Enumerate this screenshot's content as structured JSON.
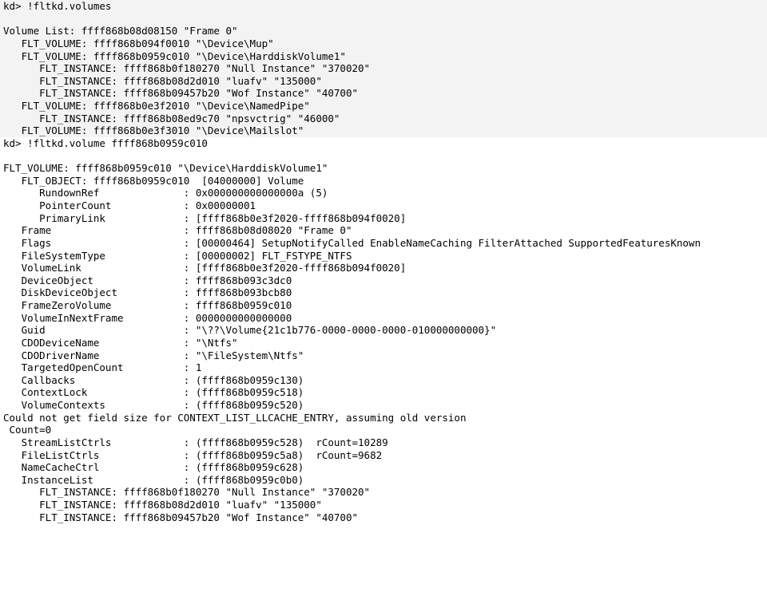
{
  "block1": {
    "prompt": "kd> ",
    "command": "!fltkd.volumes",
    "volume_list": {
      "label": "Volume List:",
      "addr": "ffff868b08d08150",
      "name": "\"Frame 0\""
    },
    "flt_volumes": [
      {
        "addr": "ffff868b094f0010",
        "name": "\"\\Device\\Mup\""
      },
      {
        "addr": "ffff868b0959c010",
        "name": "\"\\Device\\HarddiskVolume1\"",
        "instances": [
          {
            "addr": "ffff868b0f180270",
            "n1": "\"Null Instance\"",
            "n2": "\"370020\""
          },
          {
            "addr": "ffff868b08d2d010",
            "n1": "\"luafv\"",
            "n2": "\"135000\""
          },
          {
            "addr": "ffff868b09457b20",
            "n1": "\"Wof Instance\"",
            "n2": "\"40700\""
          }
        ]
      },
      {
        "addr": "ffff868b0e3f2010",
        "name": "\"\\Device\\NamedPipe\"",
        "instances": [
          {
            "addr": "ffff868b08ed9c70",
            "n1": "\"npsvctrig\"",
            "n2": "\"46000\""
          }
        ]
      },
      {
        "addr": "ffff868b0e3f3010",
        "name": "\"\\Device\\Mailslot\""
      }
    ]
  },
  "block2": {
    "prompt": "kd> ",
    "command": "!fltkd.volume ffff868b0959c010",
    "volume_header": {
      "addr": "ffff868b0959c010",
      "name": "\"\\Device\\HarddiskVolume1\""
    },
    "flt_object": {
      "addr": "ffff868b0959c010",
      "flags": "[04000000]",
      "type": "Volume"
    },
    "fields1": [
      {
        "k": "RundownRef",
        "v": "0x000000000000000a (5)"
      },
      {
        "k": "PointerCount",
        "v": "0x00000001"
      },
      {
        "k": "PrimaryLink",
        "v": "[ffff868b0e3f2020-ffff868b094f0020]"
      }
    ],
    "fields2": [
      {
        "k": "Frame",
        "v": "ffff868b08d08020 \"Frame 0\""
      },
      {
        "k": "Flags",
        "v": "[00000464] SetupNotifyCalled EnableNameCaching FilterAttached SupportedFeaturesKnown"
      },
      {
        "k": "FileSystemType",
        "v": "[00000002] FLT_FSTYPE_NTFS"
      },
      {
        "k": "VolumeLink",
        "v": "[ffff868b0e3f2020-ffff868b094f0020]"
      },
      {
        "k": "DeviceObject",
        "v": "ffff868b093c3dc0"
      },
      {
        "k": "DiskDeviceObject",
        "v": "ffff868b093bcb80"
      },
      {
        "k": "FrameZeroVolume",
        "v": "ffff868b0959c010"
      },
      {
        "k": "VolumeInNextFrame",
        "v": "0000000000000000"
      },
      {
        "k": "Guid",
        "v": "\"\\??\\Volume{21c1b776-0000-0000-0000-010000000000}\""
      },
      {
        "k": "CDODeviceName",
        "v": "\"\\Ntfs\""
      },
      {
        "k": "CDODriverName",
        "v": "\"\\FileSystem\\Ntfs\""
      },
      {
        "k": "TargetedOpenCount",
        "v": "1"
      },
      {
        "k": "Callbacks",
        "v": "(ffff868b0959c130)"
      },
      {
        "k": "ContextLock",
        "v": "(ffff868b0959c518)"
      },
      {
        "k": "VolumeContexts",
        "v": "(ffff868b0959c520)"
      }
    ],
    "warn": "Could not get field size for CONTEXT_LIST_LLCACHE_ENTRY, assuming old version",
    "count": " Count=0",
    "fields3": [
      {
        "k": "StreamListCtrls",
        "v": "(ffff868b0959c528)  rCount=10289"
      },
      {
        "k": "FileListCtrls",
        "v": "(ffff868b0959c5a8)  rCount=9682"
      },
      {
        "k": "NameCacheCtrl",
        "v": "(ffff868b0959c628)"
      },
      {
        "k": "InstanceList",
        "v": "(ffff868b0959c0b0)"
      }
    ],
    "instances": [
      {
        "addr": "ffff868b0f180270",
        "n1": "\"Null Instance\"",
        "n2": "\"370020\""
      },
      {
        "addr": "ffff868b08d2d010",
        "n1": "\"luafv\"",
        "n2": "\"135000\""
      },
      {
        "addr": "ffff868b09457b20",
        "n1": "\"Wof Instance\"",
        "n2": "\"40700\""
      }
    ]
  }
}
